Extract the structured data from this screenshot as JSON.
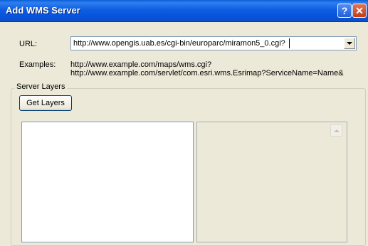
{
  "window": {
    "title": "Add WMS Server"
  },
  "controls": {
    "help_glyph": "?",
    "close_glyph": "✕"
  },
  "url": {
    "label": "URL:",
    "value": "http://www.opengis.uab.es/cgi-bin/europarc/miramon5_0.cgi?"
  },
  "examples": {
    "label": "Examples:",
    "lines": [
      "http://www.example.com/maps/wms.cgi?",
      "http://www.example.com/servlet/com.esri.wms.Esrimap?ServiceName=Name&"
    ]
  },
  "server_layers": {
    "title": "Server Layers",
    "get_layers_label": "Get Layers"
  },
  "icons": [
    "help-icon",
    "close-icon",
    "dropdown-arrow-icon",
    "scroll-up-arrow-icon"
  ]
}
